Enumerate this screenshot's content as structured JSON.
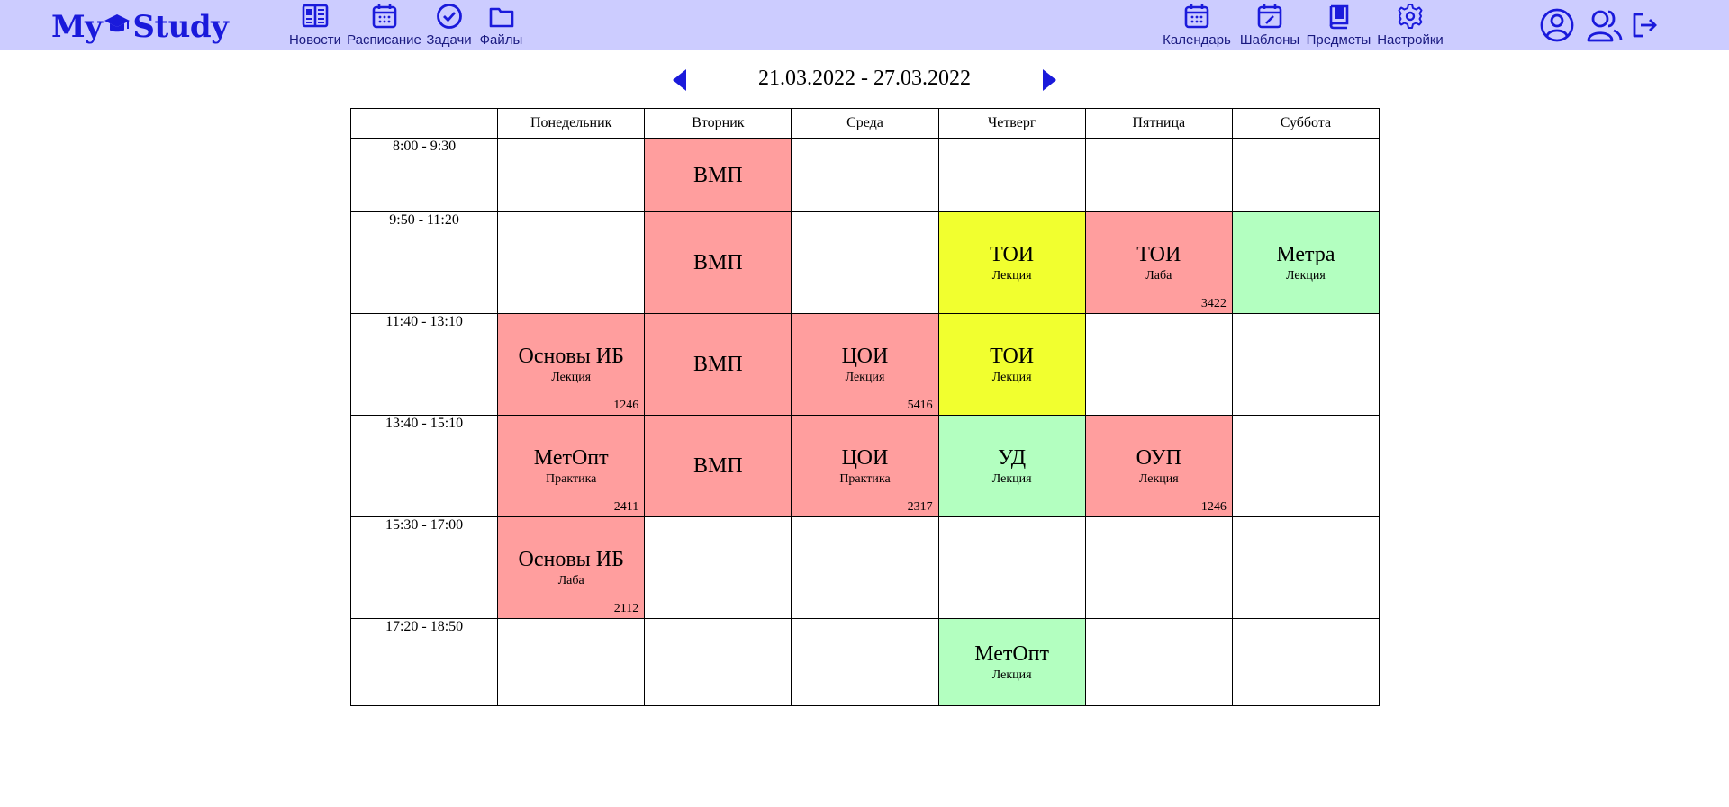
{
  "app": {
    "logo_left": "My",
    "logo_right": "Study"
  },
  "nav_left": [
    {
      "label": "Новости",
      "icon": "news-icon"
    },
    {
      "label": "Расписание",
      "icon": "calendar-icon"
    },
    {
      "label": "Задачи",
      "icon": "check-circle-icon"
    },
    {
      "label": "Файлы",
      "icon": "folder-icon"
    }
  ],
  "nav_right": [
    {
      "label": "Календарь",
      "icon": "calendar-icon"
    },
    {
      "label": "Шаблоны",
      "icon": "calendar-edit-icon"
    },
    {
      "label": "Предметы",
      "icon": "book-icon"
    },
    {
      "label": "Настройки",
      "icon": "gear-icon"
    }
  ],
  "user_icons": [
    "profile-icon",
    "users-icon",
    "logout-icon"
  ],
  "week": {
    "label": "21.03.2022 - 27.03.2022"
  },
  "colors": {
    "accent": "#1a1adb",
    "topbar": "#ccccff",
    "red": "#ff9e9e",
    "yellow": "#f1ff2f",
    "green": "#b3ffc0"
  },
  "schedule": {
    "days": [
      "Понедельник",
      "Вторник",
      "Среда",
      "Четверг",
      "Пятница",
      "Суббота"
    ],
    "rows": [
      {
        "time": "8:00 - 9:30",
        "cells": [
          null,
          {
            "subject": "ВМП",
            "type": "",
            "room": "",
            "color": "red"
          },
          null,
          null,
          null,
          null
        ]
      },
      {
        "time": "9:50 - 11:20",
        "cells": [
          null,
          {
            "subject": "ВМП",
            "type": "",
            "room": "",
            "color": "red"
          },
          null,
          {
            "subject": "ТОИ",
            "type": "Лекция",
            "room": "",
            "color": "yellow"
          },
          {
            "subject": "ТОИ",
            "type": "Лаба",
            "room": "3422",
            "color": "red"
          },
          {
            "subject": "Метра",
            "type": "Лекция",
            "room": "",
            "color": "green"
          }
        ]
      },
      {
        "time": "11:40 - 13:10",
        "cells": [
          {
            "subject": "Основы ИБ",
            "type": "Лекция",
            "room": "1246",
            "color": "red"
          },
          {
            "subject": "ВМП",
            "type": "",
            "room": "",
            "color": "red"
          },
          {
            "subject": "ЦОИ",
            "type": "Лекция",
            "room": "5416",
            "color": "red"
          },
          {
            "subject": "ТОИ",
            "type": "Лекция",
            "room": "",
            "color": "yellow"
          },
          null,
          null
        ]
      },
      {
        "time": "13:40 - 15:10",
        "cells": [
          {
            "subject": "МетОпт",
            "type": "Практика",
            "room": "2411",
            "color": "red"
          },
          {
            "subject": "ВМП",
            "type": "",
            "room": "",
            "color": "red"
          },
          {
            "subject": "ЦОИ",
            "type": "Практика",
            "room": "2317",
            "color": "red"
          },
          {
            "subject": "УД",
            "type": "Лекция",
            "room": "",
            "color": "green"
          },
          {
            "subject": "ОУП",
            "type": "Лекция",
            "room": "1246",
            "color": "red"
          },
          null
        ]
      },
      {
        "time": "15:30 - 17:00",
        "cells": [
          {
            "subject": "Основы ИБ",
            "type": "Лаба",
            "room": "2112",
            "color": "red"
          },
          null,
          null,
          null,
          null,
          null
        ]
      },
      {
        "time": "17:20 - 18:50",
        "cells": [
          null,
          null,
          null,
          {
            "subject": "МетОпт",
            "type": "Лекция",
            "room": "",
            "color": "green"
          },
          null,
          null
        ]
      }
    ]
  }
}
